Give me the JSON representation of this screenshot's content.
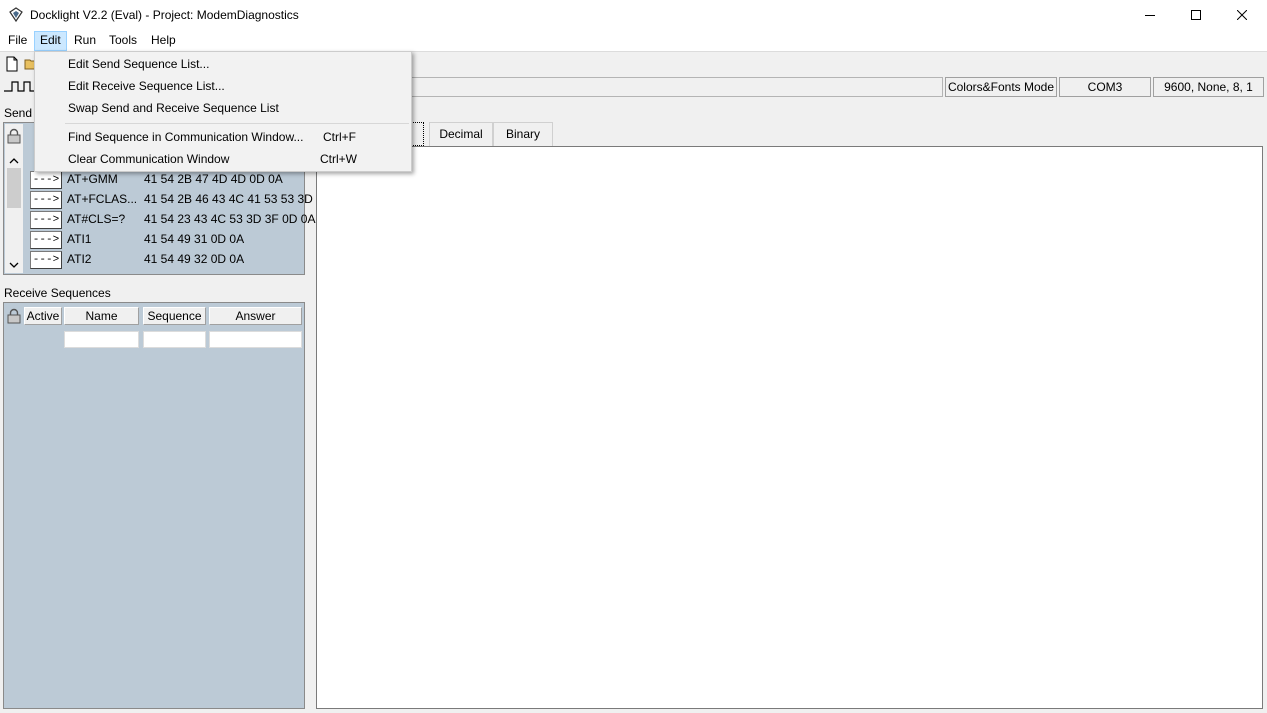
{
  "window": {
    "title": "Docklight V2.2 (Eval) - Project: ModemDiagnostics",
    "app_icon": "docklight-icon",
    "controls": [
      "minimize-icon",
      "maximize-icon",
      "close-icon"
    ]
  },
  "menubar": {
    "items": [
      {
        "label": "File",
        "name": "menu-file"
      },
      {
        "label": "Edit",
        "name": "menu-edit",
        "open": true
      },
      {
        "label": "Run",
        "name": "menu-run"
      },
      {
        "label": "Tools",
        "name": "menu-tools"
      },
      {
        "label": "Help",
        "name": "menu-help"
      }
    ]
  },
  "edit_menu": {
    "items": [
      {
        "label": "Edit Send Sequence List...",
        "shortcut": ""
      },
      {
        "label": "Edit Receive Sequence List...",
        "shortcut": ""
      },
      {
        "label": "Swap Send and Receive Sequence List",
        "shortcut": ""
      },
      {
        "label": "Find Sequence in Communication Window...",
        "shortcut": "Ctrl+F"
      },
      {
        "label": "Clear Communication Window",
        "shortcut": "Ctrl+W"
      }
    ]
  },
  "toolbar": {
    "icons": [
      "new-file-icon",
      "open-folder-icon"
    ]
  },
  "status": {
    "mode": "Colors&Fonts Mode",
    "port": "COM3",
    "settings": "9600, None, 8, 1"
  },
  "send_panel": {
    "label": "Send",
    "button_label": "--->",
    "rows": [
      {
        "name": "AT+GMM",
        "sequence": "41 54 2B 47 4D 4D 0D 0A"
      },
      {
        "name": "AT+FCLAS...",
        "sequence": "41 54 2B 46 43 4C 41 53 53 3D"
      },
      {
        "name": "AT#CLS=?",
        "sequence": "41 54 23 43 4C 53 3D 3F 0D 0A"
      },
      {
        "name": "ATI1",
        "sequence": "41 54 49 31 0D 0A"
      },
      {
        "name": "ATI2",
        "sequence": "41 54 49 32 0D 0A"
      }
    ]
  },
  "receive_panel": {
    "label": "Receive Sequences",
    "columns": [
      "Active",
      "Name",
      "Sequence",
      "Answer"
    ]
  },
  "comm_tabs": [
    {
      "label": "",
      "name": "tab-ascii",
      "focused": true
    },
    {
      "label": "Decimal",
      "name": "tab-decimal"
    },
    {
      "label": "Binary",
      "name": "tab-binary"
    }
  ]
}
